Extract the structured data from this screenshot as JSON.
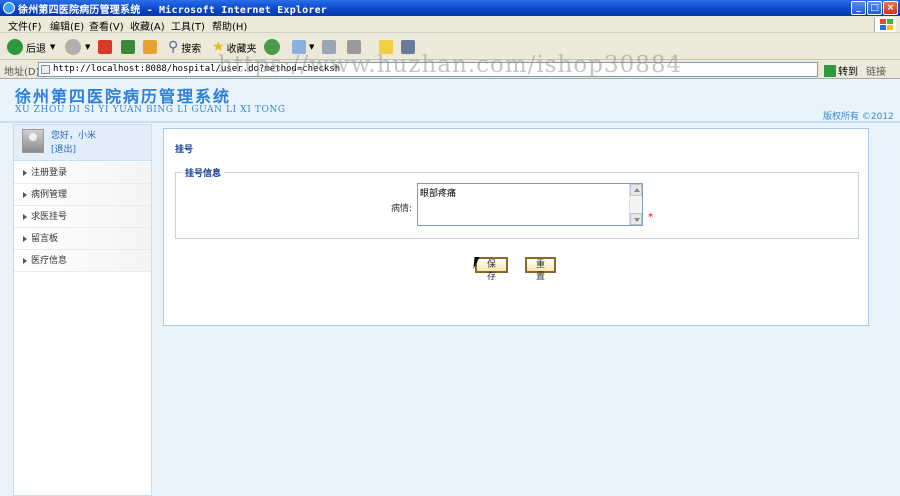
{
  "window": {
    "title": "徐州第四医院病历管理系统 - Microsoft Internet Explorer",
    "controls": {
      "minimize": "_",
      "maximize": "□",
      "close": "×"
    }
  },
  "menu": [
    "文件(F)",
    "编辑(E)",
    "查看(V)",
    "收藏(A)",
    "工具(T)",
    "帮助(H)"
  ],
  "toolbar": {
    "back_label": "后退",
    "search_label": "搜索",
    "favorites_label": "收藏夹",
    "colors": {
      "back": "#2c9a3c",
      "stop": "#d83a2a",
      "refresh": "#3a8a3a",
      "home": "#e8a030"
    }
  },
  "address": {
    "label": "地址(D)",
    "url": "http://localhost:8088/hospital/user.do?method=checksh",
    "go_label": "转到",
    "links_label": "链接"
  },
  "watermark": "https://www.huzhan.com/ishop30884",
  "header": {
    "title": "徐州第四医院病历管理系统",
    "subtitle": "XU ZHOU DI SI YI YUAN BING LI GUAN LI XI TONG",
    "copyright": "版权所有  ©2012"
  },
  "user": {
    "greeting": "您好，小米",
    "logout": "[退出]"
  },
  "nav": [
    {
      "label": "注册登录"
    },
    {
      "label": "病例管理"
    },
    {
      "label": "求医挂号"
    },
    {
      "label": "留言板"
    },
    {
      "label": "医疗信息"
    }
  ],
  "form": {
    "panel_title": "挂号",
    "legend": "挂号信息",
    "condition_label": "病情:",
    "condition_value": "眼部疼痛",
    "required_mark": "*",
    "save_label": "保存",
    "reset_label": "重置"
  },
  "colors": {
    "accent": "#2e7fd8",
    "page_bg": "#e8f3fc",
    "button_border": "#8a6a2a",
    "title_bar": "#0a44c8"
  }
}
